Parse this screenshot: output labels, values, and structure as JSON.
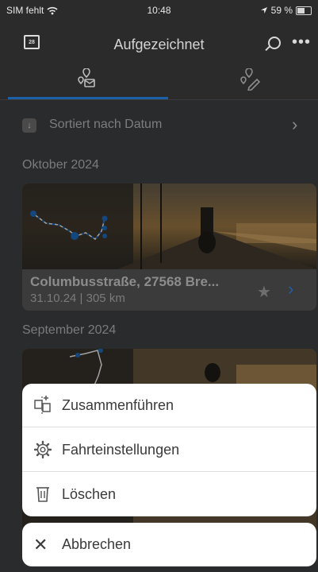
{
  "status_bar": {
    "carrier": "SIM fehlt",
    "time": "10:48",
    "battery": "59 %"
  },
  "nav": {
    "title": "Aufgezeichnet",
    "calendar_day": "28"
  },
  "sort": {
    "label": "Sortiert nach Datum",
    "icon_glyph": "↓"
  },
  "sections": [
    {
      "month": "Oktober 2024",
      "trip": {
        "title": "Columbusstraße, 27568 Bre...",
        "meta": "31.10.24 | 305 km"
      }
    },
    {
      "month": "September 2024"
    }
  ],
  "action_sheet": {
    "items": [
      {
        "label": "Zusammenführen",
        "icon": "merge-icon"
      },
      {
        "label": "Fahrteinstellungen",
        "icon": "gear-icon"
      },
      {
        "label": "Löschen",
        "icon": "trash-icon"
      }
    ],
    "cancel": {
      "label": "Abbrechen",
      "icon": "close-icon"
    }
  },
  "colors": {
    "accent": "#1B5FA8",
    "overlay": "#2A2B2C",
    "sheet": "#FFFFFF"
  }
}
